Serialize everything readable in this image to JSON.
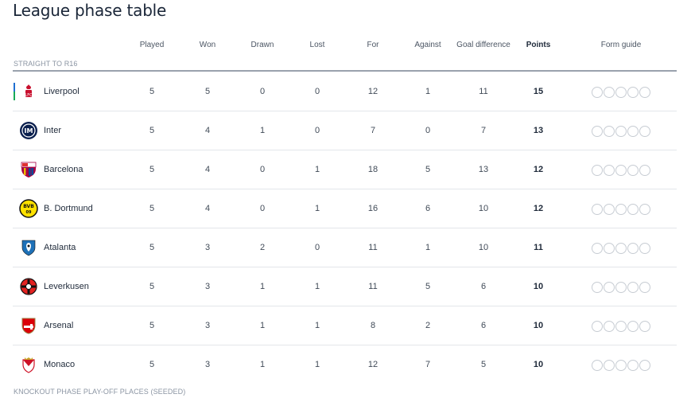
{
  "title": "League phase table",
  "columns": {
    "played": "Played",
    "won": "Won",
    "drawn": "Drawn",
    "lost": "Lost",
    "for": "For",
    "against": "Against",
    "gd": "Goal difference",
    "points": "Points",
    "form": "Form guide"
  },
  "sections": {
    "top": "STRAIGHT TO R16",
    "bottom": "KNOCKOUT PHASE PLAY-OFF PLACES (SEEDED)"
  },
  "rows": [
    {
      "team": "Liverpool",
      "played": "5",
      "won": "5",
      "drawn": "0",
      "lost": "0",
      "for": "12",
      "against": "1",
      "gd": "11",
      "points": "15",
      "crest": "liverpool-crest-icon"
    },
    {
      "team": "Inter",
      "played": "5",
      "won": "4",
      "drawn": "1",
      "lost": "0",
      "for": "7",
      "against": "0",
      "gd": "7",
      "points": "13",
      "crest": "inter-crest-icon"
    },
    {
      "team": "Barcelona",
      "played": "5",
      "won": "4",
      "drawn": "0",
      "lost": "1",
      "for": "18",
      "against": "5",
      "gd": "13",
      "points": "12",
      "crest": "barcelona-crest-icon"
    },
    {
      "team": "B. Dortmund",
      "played": "5",
      "won": "4",
      "drawn": "0",
      "lost": "1",
      "for": "16",
      "against": "6",
      "gd": "10",
      "points": "12",
      "crest": "dortmund-crest-icon"
    },
    {
      "team": "Atalanta",
      "played": "5",
      "won": "3",
      "drawn": "2",
      "lost": "0",
      "for": "11",
      "against": "1",
      "gd": "10",
      "points": "11",
      "crest": "atalanta-crest-icon"
    },
    {
      "team": "Leverkusen",
      "played": "5",
      "won": "3",
      "drawn": "1",
      "lost": "1",
      "for": "11",
      "against": "5",
      "gd": "6",
      "points": "10",
      "crest": "leverkusen-crest-icon"
    },
    {
      "team": "Arsenal",
      "played": "5",
      "won": "3",
      "drawn": "1",
      "lost": "1",
      "for": "8",
      "against": "2",
      "gd": "6",
      "points": "10",
      "crest": "arsenal-crest-icon"
    },
    {
      "team": "Monaco",
      "played": "5",
      "won": "3",
      "drawn": "1",
      "lost": "1",
      "for": "12",
      "against": "7",
      "gd": "5",
      "points": "10",
      "crest": "monaco-crest-icon"
    }
  ],
  "colors": {
    "qualify_blue": "#1f6fd1",
    "qualify_green": "#18a957"
  }
}
